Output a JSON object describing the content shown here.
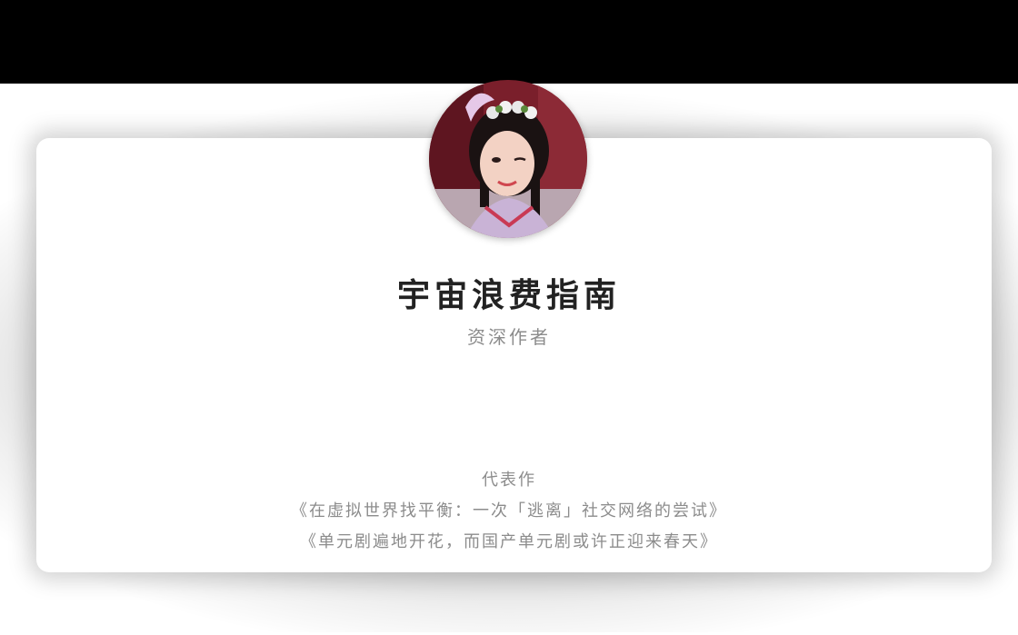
{
  "author": {
    "name": "宇宙浪费指南",
    "role": "资深作者"
  },
  "works": {
    "heading": "代表作",
    "items": [
      "《在虚拟世界找平衡：一次「逃离」社交网络的尝试》",
      "《单元剧遍地开花，而国产单元剧或许正迎来春天》"
    ]
  }
}
